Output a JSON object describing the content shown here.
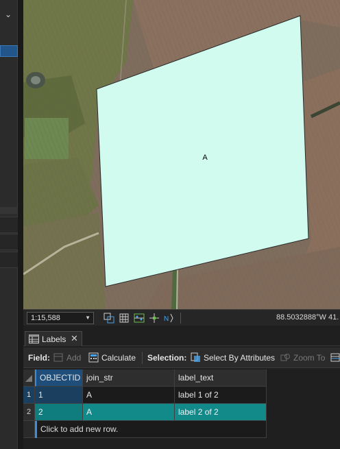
{
  "map": {
    "polygon_label": "A",
    "colors": {
      "polygon_fill": "#d2fbef",
      "polygon_stroke": "#222222"
    }
  },
  "status_bar": {
    "scale": "1:15,588",
    "coordinate_readout": "88.5032888°W 41.",
    "tool_icons": [
      "navigate-select-icon",
      "grid-icon",
      "snapping-icon",
      "constraints-icon",
      "north-arrow-icon"
    ]
  },
  "attribute_pane": {
    "tab": {
      "label": "Labels",
      "icon": "table-icon",
      "close_icon": "close-icon"
    },
    "toolbar": {
      "field_label": "Field:",
      "add_label": "Add",
      "calculate_label": "Calculate",
      "selection_label": "Selection:",
      "select_by_attributes_label": "Select By Attributes",
      "zoom_to_label": "Zoom To"
    },
    "table": {
      "columns": [
        "OBJECTID *",
        "join_str",
        "label_text"
      ],
      "rows": [
        {
          "row_number": "1",
          "objectid": "1",
          "join_str": "A",
          "label_text": "label 1 of 2"
        },
        {
          "row_number": "2",
          "objectid": "2",
          "join_str": "A",
          "label_text": "label 2 of 2"
        }
      ],
      "add_row_text": "Click to add new row."
    },
    "colors": {
      "selected_row": "#128a8a",
      "header_sorted": "#1f4e7a"
    }
  }
}
